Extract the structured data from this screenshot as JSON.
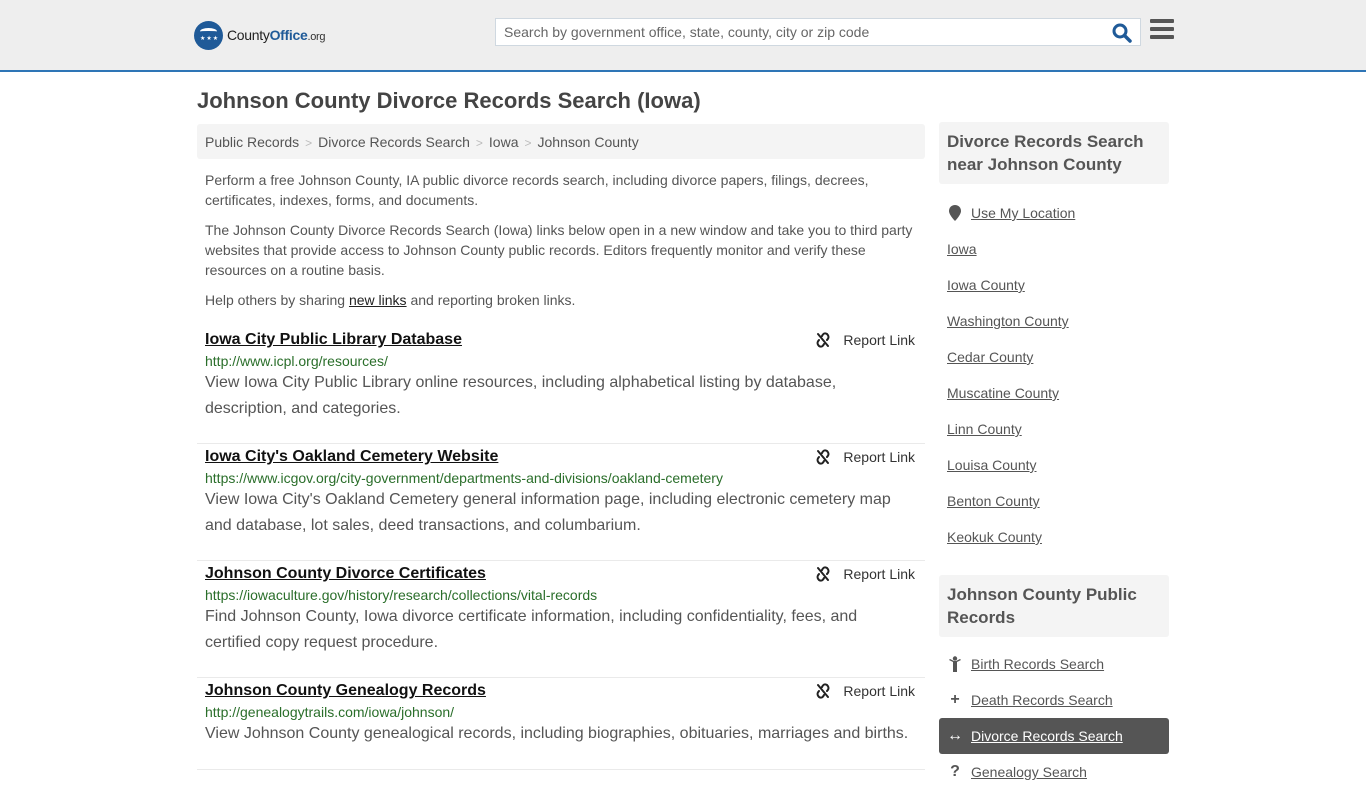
{
  "header": {
    "logo": {
      "name": "County",
      "brand": "Office",
      "tld": ".org"
    },
    "search": {
      "placeholder": "Search by government office, state, county, city or zip code",
      "value": ""
    }
  },
  "page_title": "Johnson County Divorce Records Search (Iowa)",
  "breadcrumb": [
    "Public Records",
    "Divorce Records Search",
    "Iowa",
    "Johnson County"
  ],
  "intro": {
    "p1": "Perform a free Johnson County, IA public divorce records search, including divorce papers, filings, decrees, certificates, indexes, forms, and documents.",
    "p2": "The Johnson County Divorce Records Search (Iowa) links below open in a new window and take you to third party websites that provide access to Johnson County public records. Editors frequently monitor and verify these resources on a routine basis.",
    "p3_before": "Help others by sharing ",
    "p3_link": "new links",
    "p3_after": " and reporting broken links."
  },
  "report_label": "Report Link",
  "listings": [
    {
      "title": "Iowa City Public Library Database",
      "url": "http://www.icpl.org/resources/",
      "desc": "View Iowa City Public Library online resources, including alphabetical listing by database, description, and categories."
    },
    {
      "title": "Iowa City's Oakland Cemetery Website",
      "url": "https://www.icgov.org/city-government/departments-and-divisions/oakland-cemetery",
      "desc": "View Iowa City's Oakland Cemetery general information page, including electronic cemetery map and database, lot sales, deed transactions, and columbarium."
    },
    {
      "title": "Johnson County Divorce Certificates",
      "url": "https://iowaculture.gov/history/research/collections/vital-records",
      "desc": "Find Johnson County, Iowa divorce certificate information, including confidentiality, fees, and certified copy request procedure."
    },
    {
      "title": "Johnson County Genealogy Records",
      "url": "http://genealogytrails.com/iowa/johnson/",
      "desc": "View Johnson County genealogical records, including biographies, obituaries, marriages and births."
    }
  ],
  "sidebar": {
    "nearby_heading": "Divorce Records Search near Johnson County",
    "use_location": "Use My Location",
    "nearby": [
      "Iowa",
      "Iowa County",
      "Washington County",
      "Cedar County",
      "Muscatine County",
      "Linn County",
      "Louisa County",
      "Benton County",
      "Keokuk County"
    ],
    "records_heading": "Johnson County Public Records",
    "records": [
      {
        "label": "Birth Records Search",
        "icon": "child-icon",
        "active": false
      },
      {
        "label": "Death Records Search",
        "icon": "plus-icon",
        "active": false
      },
      {
        "label": "Divorce Records Search",
        "icon": "arrows-horizontal-icon",
        "active": true
      },
      {
        "label": "Genealogy Search",
        "icon": "question-icon",
        "active": false
      }
    ]
  },
  "colors": {
    "accent": "#2e75b6",
    "brand": "#1f5a98",
    "url_green": "#2a6e2a",
    "active_bg": "#555555"
  }
}
